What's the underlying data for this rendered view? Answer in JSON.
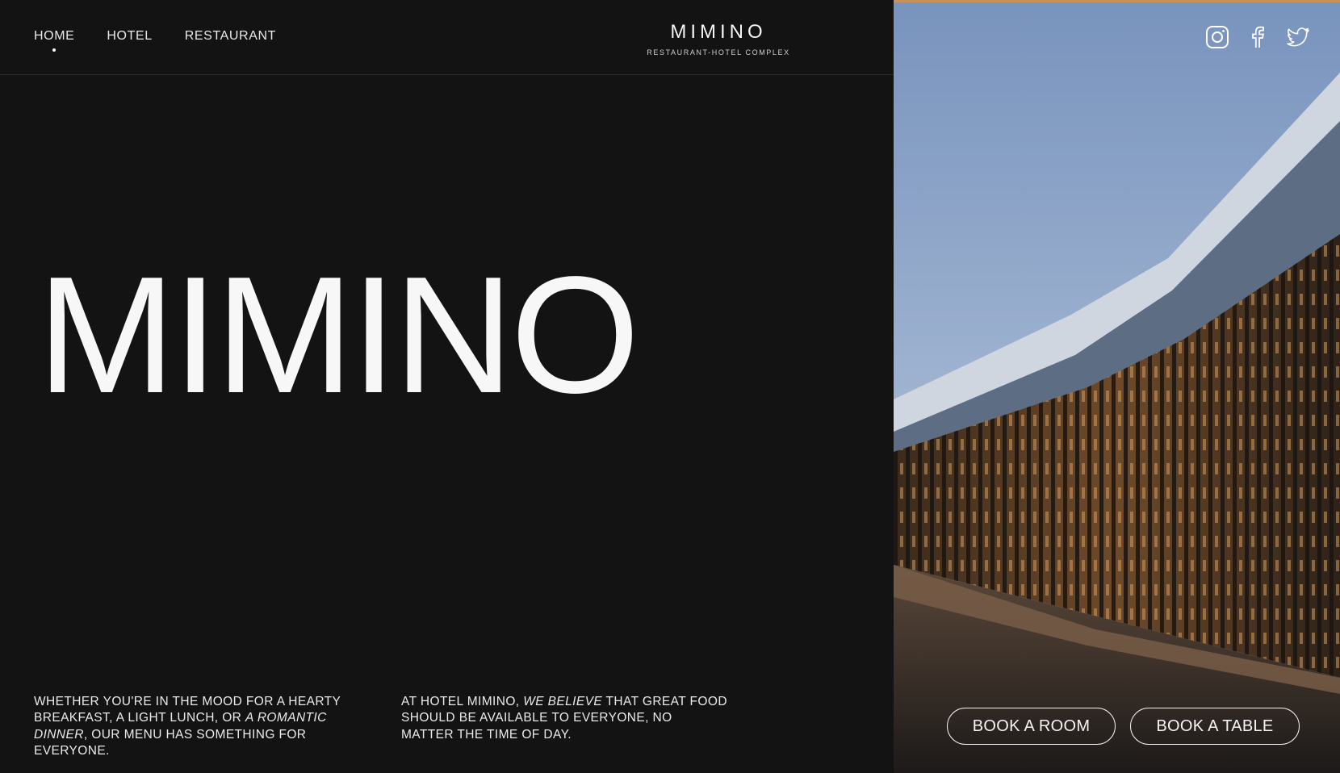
{
  "nav": {
    "items": [
      "HOME",
      "HOTEL",
      "RESTAURANT"
    ],
    "active": "HOME"
  },
  "brand": {
    "name": "MIMINO",
    "subtitle": "RESTAURANT-HOTEL COMPLEX"
  },
  "hero": {
    "title": "MIMINO"
  },
  "copy": {
    "left": {
      "pre": "WHETHER YOU'RE IN THE MOOD FOR A HEARTY BREAKFAST, A LIGHT LUNCH, OR ",
      "emph": "A ROMANTIC DINNER",
      "post": ", OUR MENU HAS SOMETHING FOR EVERYONE."
    },
    "right": {
      "pre": "AT HOTEL MIMINO, ",
      "emph": "WE BELIEVE",
      "post": " THAT GREAT FOOD SHOULD BE AVAILABLE TO EVERYONE, NO MATTER THE TIME OF DAY."
    }
  },
  "social": {
    "icons": [
      "instagram-icon",
      "facebook-icon",
      "twitter-icon"
    ]
  },
  "buttons": {
    "book_room": "BOOK A ROOM",
    "book_table": "BOOK  A TABLE"
  },
  "colors": {
    "background": "#131313",
    "text": "#f2f2f2",
    "sky": "#6c8cbb",
    "facade_warm": "#b97c45"
  }
}
